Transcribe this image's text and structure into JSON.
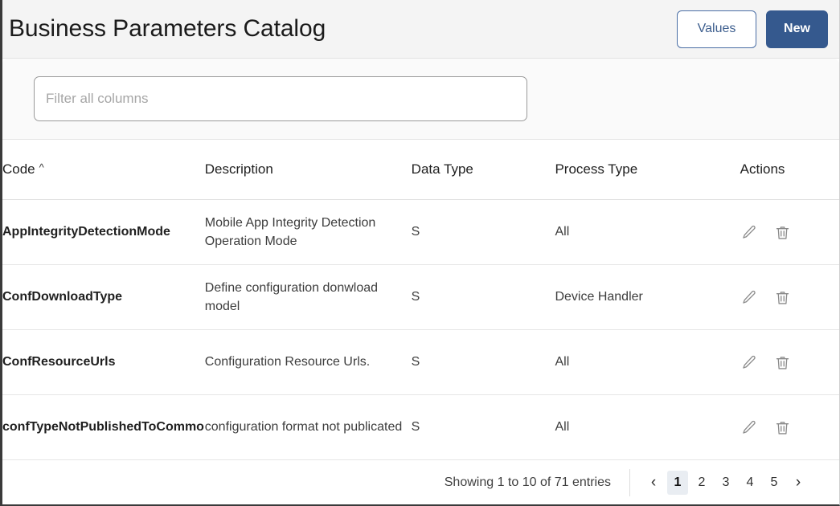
{
  "header": {
    "title": "Business Parameters Catalog",
    "values_button": "Values",
    "new_button": "New"
  },
  "filter": {
    "placeholder": "Filter all columns",
    "value": ""
  },
  "table": {
    "columns": [
      {
        "label": "Code",
        "sort": "^"
      },
      {
        "label": "Description"
      },
      {
        "label": "Data Type"
      },
      {
        "label": "Process Type"
      },
      {
        "label": "Actions"
      }
    ],
    "rows": [
      {
        "code": "AppIntegrityDetectionMode",
        "description": "Mobile App Integrity Detection Operation Mode",
        "data_type": "S",
        "process_type": "All"
      },
      {
        "code": "ConfDownloadType",
        "description": "Define configuration donwload model",
        "data_type": "S",
        "process_type": "Device Handler"
      },
      {
        "code": "ConfResourceUrls",
        "description": "Configuration Resource Urls.",
        "data_type": "S",
        "process_type": "All"
      },
      {
        "code": "confTypeNotPublishedToCommon",
        "description": "configuration format not publicated",
        "data_type": "S",
        "process_type": "All"
      }
    ],
    "row_actions": {
      "edit_icon": "pencil-icon",
      "delete_icon": "trash-icon"
    }
  },
  "footer": {
    "entries_info": "Showing 1 to 10 of 71 entries",
    "prev_label": "‹",
    "next_label": "›",
    "pages": [
      "1",
      "2",
      "3",
      "4",
      "5"
    ],
    "active_page": "1"
  },
  "colors": {
    "primary": "#35598e",
    "outline_border": "#4a6ea5",
    "header_bg": "#f4f4f4",
    "active_page_bg": "#e9edf2"
  }
}
